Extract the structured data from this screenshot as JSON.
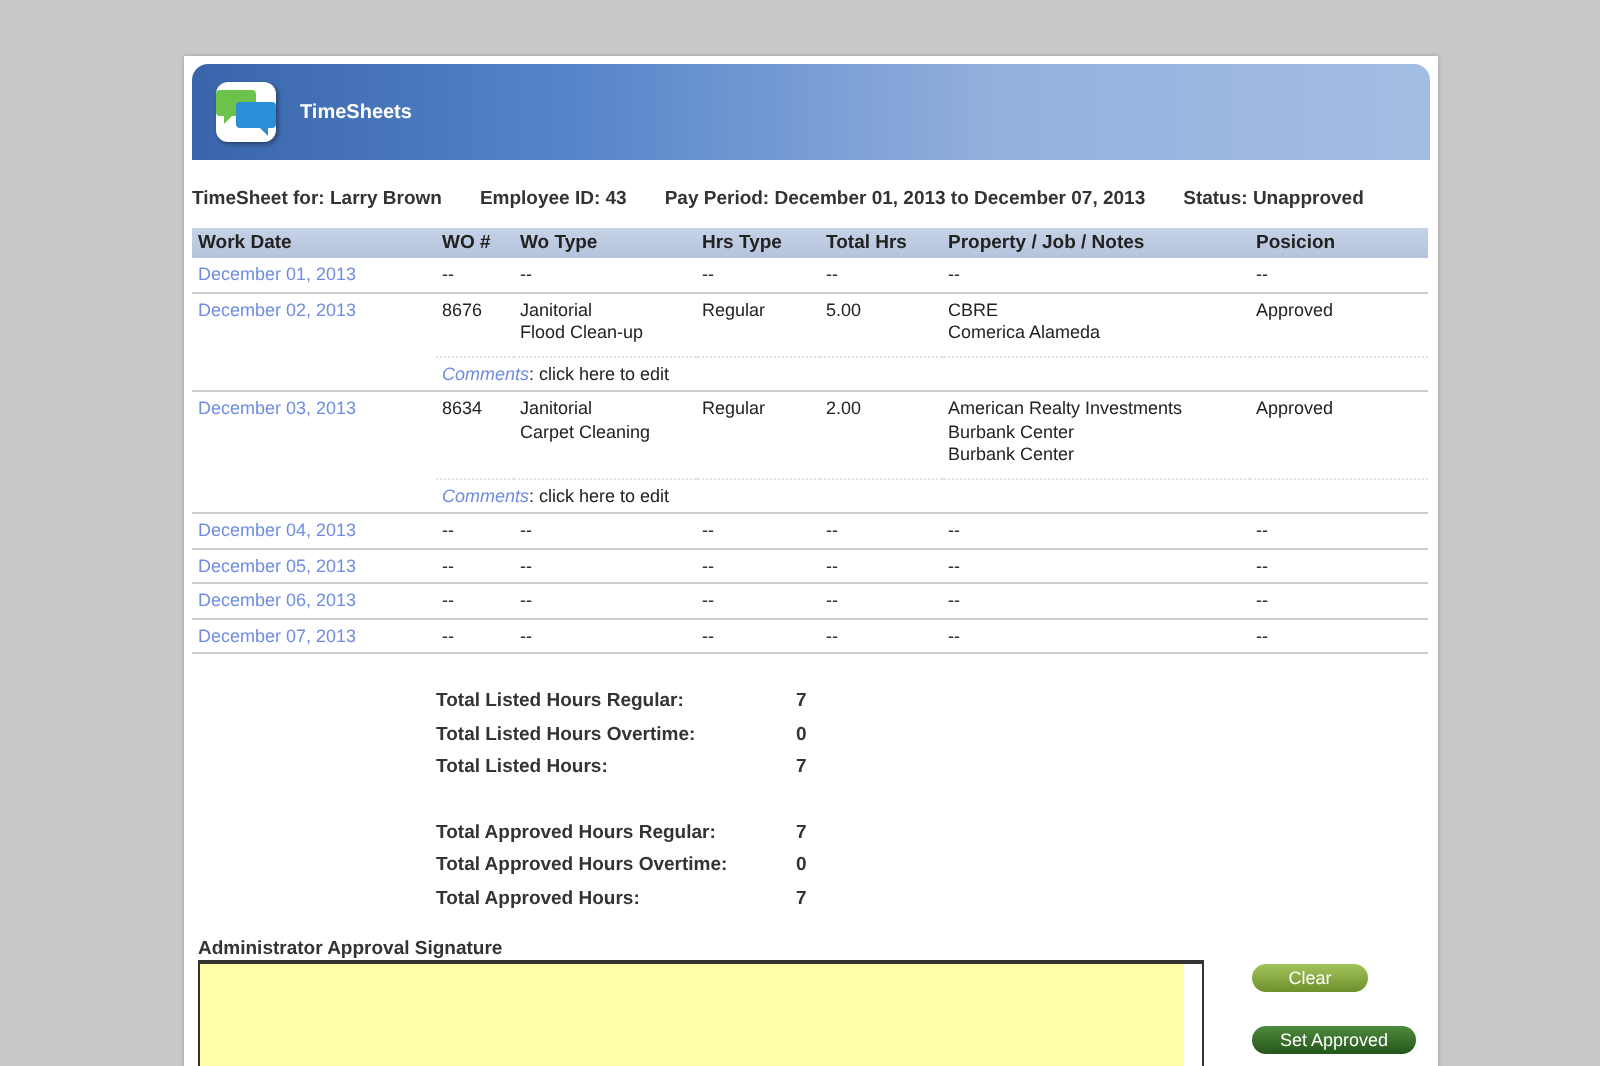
{
  "header": {
    "title": "TimeSheets"
  },
  "info": [
    "TimeSheet for: Larry Brown",
    "Employee ID: 43",
    "Pay Period: December 01, 2013 to December 07, 2013",
    "Status: Unapproved"
  ],
  "table": {
    "columns": [
      "Work Date",
      "WO #",
      "Wo Type",
      "Hrs Type",
      "Total Hrs",
      "Property / Job / Notes",
      "Posicion"
    ],
    "rows": [
      {
        "cells": [
          [
            "December 01, 2013"
          ],
          [
            "--"
          ],
          [
            "--"
          ],
          [
            "--"
          ],
          [
            "--"
          ],
          [
            "--"
          ],
          [
            "--"
          ]
        ]
      },
      {
        "cells": [
          [
            "December 02, 2013"
          ],
          [
            "8676"
          ],
          [
            "Janitorial",
            "Flood Clean-up"
          ],
          [
            "Regular"
          ],
          [
            "5.00"
          ],
          [
            "CBRE",
            "Comerica Alameda"
          ],
          [
            "Approved"
          ]
        ],
        "comment": {
          "link": "Comments",
          "text": ": click here to edit"
        }
      },
      {
        "cells": [
          [
            "December 03, 2013"
          ],
          [
            "8634"
          ],
          [
            "Janitorial",
            "Carpet Cleaning"
          ],
          [
            "Regular"
          ],
          [
            "2.00"
          ],
          [
            "American Realty Investments",
            "Burbank Center",
            "Burbank Center"
          ],
          [
            "Approved"
          ]
        ],
        "comment": {
          "link": "Comments",
          "text": ": click here to edit"
        }
      },
      {
        "cells": [
          [
            "December 04, 2013"
          ],
          [
            "--"
          ],
          [
            "--"
          ],
          [
            "--"
          ],
          [
            "--"
          ],
          [
            "--"
          ],
          [
            "--"
          ]
        ]
      },
      {
        "cells": [
          [
            "December 05, 2013"
          ],
          [
            "--"
          ],
          [
            "--"
          ],
          [
            "--"
          ],
          [
            "--"
          ],
          [
            "--"
          ],
          [
            "--"
          ]
        ]
      },
      {
        "cells": [
          [
            "December 06, 2013"
          ],
          [
            "--"
          ],
          [
            "--"
          ],
          [
            "--"
          ],
          [
            "--"
          ],
          [
            "--"
          ],
          [
            "--"
          ]
        ]
      },
      {
        "cells": [
          [
            "December 07, 2013"
          ],
          [
            "--"
          ],
          [
            "--"
          ],
          [
            "--"
          ],
          [
            "--"
          ],
          [
            "--"
          ],
          [
            "--"
          ]
        ]
      }
    ]
  },
  "totals": [
    [
      {
        "label": "Total Listed Hours Regular:",
        "value": "7"
      },
      {
        "label": "Total Listed Hours Overtime:",
        "value": "0"
      },
      {
        "label": "Total Listed Hours:",
        "value": "7"
      }
    ],
    [
      {
        "label": "Total Approved Hours Regular:",
        "value": "7"
      },
      {
        "label": "Total Approved Hours Overtime:",
        "value": "0"
      },
      {
        "label": "Total Approved Hours:",
        "value": "7"
      }
    ]
  ],
  "signature": {
    "label": "Administrator Approval Signature"
  },
  "buttons": [
    {
      "label": "Clear",
      "kind": "light"
    },
    {
      "label": "Set Approved",
      "kind": "dark"
    }
  ]
}
